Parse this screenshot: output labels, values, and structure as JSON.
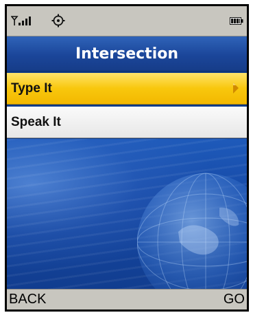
{
  "screen": {
    "title": "Intersection"
  },
  "status_bar": {
    "icons": [
      "signal-strength-icon",
      "gps-icon",
      "battery-icon"
    ]
  },
  "menu": {
    "items": [
      {
        "label": "Type It",
        "selected": true,
        "icon": "chevron-right-icon"
      },
      {
        "label": "Speak It",
        "selected": false
      }
    ]
  },
  "softkeys": {
    "left_label": "BACK",
    "right_label": "GO"
  },
  "colors": {
    "highlight": "#f8c70d",
    "title_bar": "#1b469a",
    "status_bar": "#c8c6bf"
  }
}
